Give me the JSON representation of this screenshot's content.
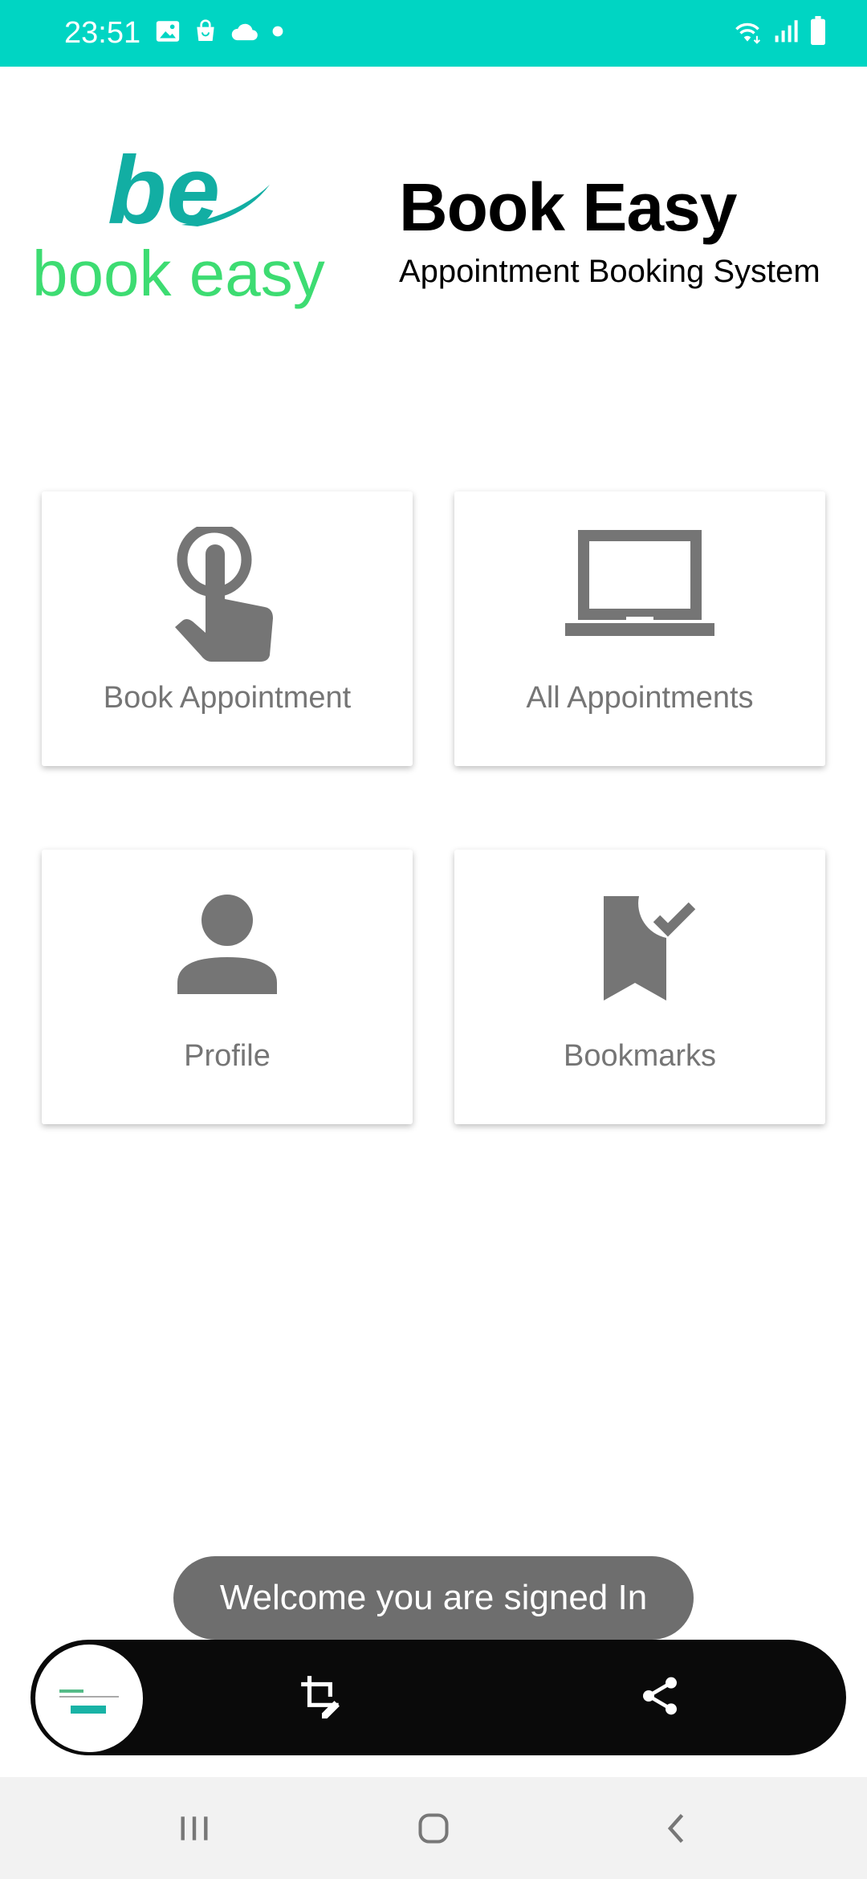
{
  "status_bar": {
    "time": "23:51",
    "bg_color": "#00d5c3",
    "left_icons": [
      "image-icon",
      "shopping-bag-icon",
      "cloud-icon",
      "dot-icon"
    ],
    "right_icons": [
      "wifi-icon",
      "signal-icon",
      "battery-icon"
    ]
  },
  "header": {
    "logo_mark": "be",
    "logo_text": "book easy",
    "title": "Book Easy",
    "subtitle": "Appointment Booking System"
  },
  "menu": {
    "items": [
      {
        "label": "Book Appointment",
        "icon": "touch-icon"
      },
      {
        "label": "All Appointments",
        "icon": "laptop-icon"
      },
      {
        "label": "Profile",
        "icon": "person-icon"
      },
      {
        "label": "Bookmarks",
        "icon": "bookmark-check-icon"
      }
    ]
  },
  "toast": {
    "message": "Welcome you are signed In"
  },
  "capture_bar": {
    "icons": [
      "crop-edit-icon",
      "share-icon"
    ]
  },
  "nav_bar": {
    "icons": [
      "recent-apps-icon",
      "home-icon",
      "back-icon"
    ]
  },
  "colors": {
    "accent": "#00d5c3",
    "logo_teal": "#12aea3",
    "logo_green": "#3ddc72",
    "icon_gray": "#757575"
  }
}
